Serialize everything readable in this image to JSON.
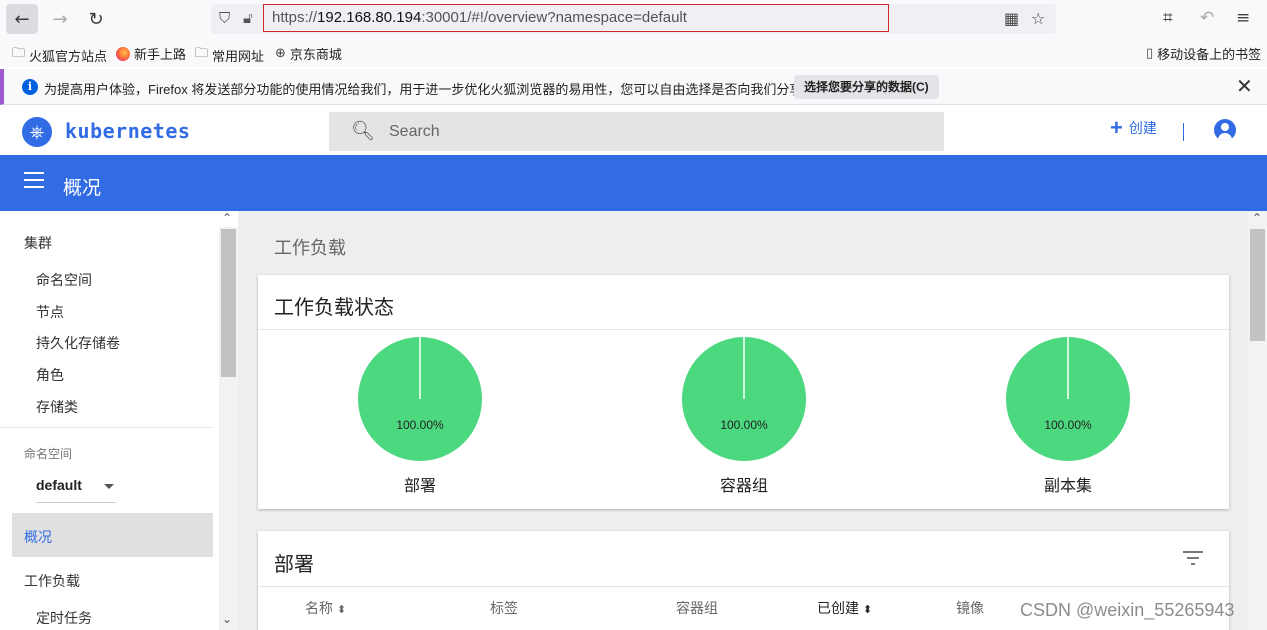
{
  "browser": {
    "url_prefix": "https://",
    "url_host": "192.168.80.194",
    "url_rest": ":30001/#!/overview?namespace=default",
    "bookmarks": [
      "火狐官方站点",
      "新手上路",
      "常用网址",
      "京东商城"
    ],
    "mobile_bookmarks": "移动设备上的书签",
    "notice_text": "为提高用户体验，Firefox 将发送部分功能的使用情况给我们，用于进一步优化火狐浏览器的易用性，您可以自由选择是否向我们分享数据。",
    "notice_button": "选择您要分享的数据(C)"
  },
  "header": {
    "brand": "kubernetes",
    "search_placeholder": "Search",
    "create_label": "创建"
  },
  "bluebar": {
    "title": "概况"
  },
  "sidebar": {
    "cluster_group": "集群",
    "cluster_items": [
      "命名空间",
      "节点",
      "持久化存储卷",
      "角色",
      "存储类"
    ],
    "namespace_label": "命名空间",
    "namespace_value": "default",
    "active_item": "概况",
    "workloads_group": "工作负载",
    "workload_items": [
      "定时任务"
    ]
  },
  "main": {
    "section_title": "工作负载",
    "status_card": {
      "title": "工作负载状态",
      "pies": [
        {
          "label": "部署",
          "percent": "100.00%",
          "value": 100
        },
        {
          "label": "容器组",
          "percent": "100.00%",
          "value": 100
        },
        {
          "label": "副本集",
          "percent": "100.00%",
          "value": 100
        }
      ]
    },
    "deployments_card": {
      "title": "部署",
      "columns": [
        "名称",
        "标签",
        "容器组",
        "已创建",
        "镜像"
      ]
    }
  },
  "colors": {
    "k8s_blue": "#326ce5",
    "pie_green": "#4cd87f",
    "url_box_red": "#d0252a"
  },
  "watermark": "CSDN @weixin_55265943"
}
